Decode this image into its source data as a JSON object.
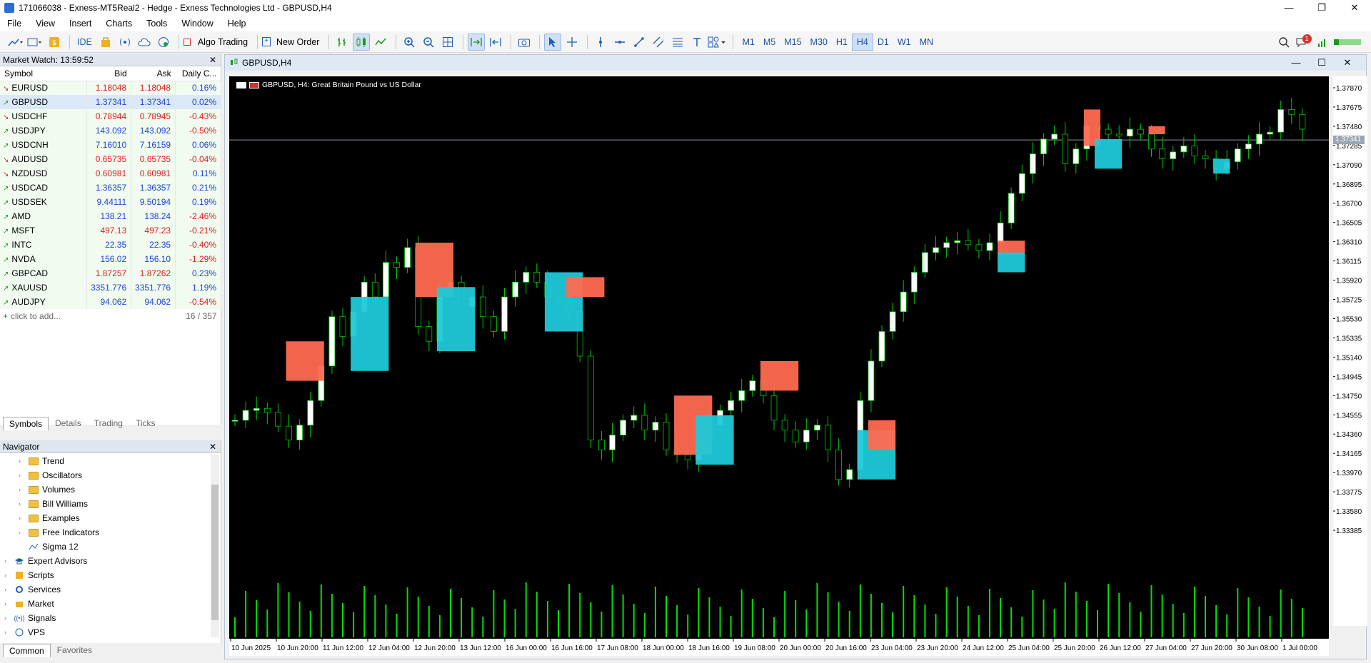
{
  "window": {
    "title": "171066038 - Exness-MT5Real2 - Hedge - Exness Technologies Ltd - GBPUSD,H4",
    "controls": [
      "—",
      "❐",
      "✕"
    ]
  },
  "menu": [
    "File",
    "View",
    "Insert",
    "Charts",
    "Tools",
    "Window",
    "Help"
  ],
  "toolbar": {
    "ide": "IDE",
    "algo_trading": "Algo Trading",
    "new_order": "New Order",
    "timeframes": [
      "M1",
      "M5",
      "M15",
      "M30",
      "H1",
      "H4",
      "D1",
      "W1",
      "MN"
    ],
    "active_timeframe": "H4",
    "notifications": "1"
  },
  "market_watch": {
    "title": "Market Watch: 13:59:52",
    "columns": [
      "Symbol",
      "Bid",
      "Ask",
      "Daily C..."
    ],
    "rows": [
      {
        "symbol": "EURUSD",
        "dir": "down",
        "bid": "1.18048",
        "ask": "1.18048",
        "change": "0.16%",
        "color": "red"
      },
      {
        "symbol": "GBPUSD",
        "dir": "up",
        "bid": "1.37341",
        "ask": "1.37341",
        "change": "0.02%",
        "color": "blue"
      },
      {
        "symbol": "USDCHF",
        "dir": "down",
        "bid": "0.78944",
        "ask": "0.78945",
        "change": "-0.43%",
        "color": "red"
      },
      {
        "symbol": "USDJPY",
        "dir": "up",
        "bid": "143.092",
        "ask": "143.092",
        "change": "-0.50%",
        "color": "blue"
      },
      {
        "symbol": "USDCNH",
        "dir": "up",
        "bid": "7.16010",
        "ask": "7.16159",
        "change": "0.06%",
        "color": "blue"
      },
      {
        "symbol": "AUDUSD",
        "dir": "down",
        "bid": "0.65735",
        "ask": "0.65735",
        "change": "-0.04%",
        "color": "red"
      },
      {
        "symbol": "NZDUSD",
        "dir": "down",
        "bid": "0.60981",
        "ask": "0.60981",
        "change": "0.11%",
        "color": "red"
      },
      {
        "symbol": "USDCAD",
        "dir": "up",
        "bid": "1.36357",
        "ask": "1.36357",
        "change": "0.21%",
        "color": "blue"
      },
      {
        "symbol": "USDSEK",
        "dir": "up",
        "bid": "9.44111",
        "ask": "9.50194",
        "change": "0.19%",
        "color": "blue"
      },
      {
        "symbol": "AMD",
        "dir": "up",
        "bid": "138.21",
        "ask": "138.24",
        "change": "-2.46%",
        "color": "blue"
      },
      {
        "symbol": "MSFT",
        "dir": "up",
        "bid": "497.13",
        "ask": "497.23",
        "change": "-0.21%",
        "color": "red"
      },
      {
        "symbol": "INTC",
        "dir": "up",
        "bid": "22.35",
        "ask": "22.35",
        "change": "-0.40%",
        "color": "blue"
      },
      {
        "symbol": "NVDA",
        "dir": "up",
        "bid": "156.02",
        "ask": "156.10",
        "change": "-1.29%",
        "color": "blue"
      },
      {
        "symbol": "GBPCAD",
        "dir": "up",
        "bid": "1.87257",
        "ask": "1.87262",
        "change": "0.23%",
        "color": "red"
      },
      {
        "symbol": "XAUUSD",
        "dir": "up",
        "bid": "3351.776",
        "ask": "3351.776",
        "change": "1.19%",
        "color": "blue"
      },
      {
        "symbol": "AUDJPY",
        "dir": "up",
        "bid": "94.062",
        "ask": "94.062",
        "change": "-0.54%",
        "color": "blue"
      }
    ],
    "add_label": "click to add...",
    "count": "16 / 357",
    "tabs": [
      "Symbols",
      "Details",
      "Trading",
      "Ticks"
    ]
  },
  "navigator": {
    "title": "Navigator",
    "items": [
      {
        "label": "Trend",
        "level": 2,
        "icon": "folder"
      },
      {
        "label": "Oscillators",
        "level": 2,
        "icon": "folder"
      },
      {
        "label": "Volumes",
        "level": 2,
        "icon": "folder"
      },
      {
        "label": "Bill Williams",
        "level": 2,
        "icon": "folder"
      },
      {
        "label": "Examples",
        "level": 2,
        "icon": "folder"
      },
      {
        "label": "Free Indicators",
        "level": 2,
        "icon": "folder"
      },
      {
        "label": "Sigma 12",
        "level": 2,
        "icon": "indicator"
      },
      {
        "label": "Expert Advisors",
        "level": 1,
        "icon": "hat"
      },
      {
        "label": "Scripts",
        "level": 1,
        "icon": "script"
      },
      {
        "label": "Services",
        "level": 1,
        "icon": "service"
      },
      {
        "label": "Market",
        "level": 1,
        "icon": "market"
      },
      {
        "label": "Signals",
        "level": 1,
        "icon": "signal"
      },
      {
        "label": "VPS",
        "level": 1,
        "icon": "vps"
      }
    ],
    "tabs": [
      "Common",
      "Favorites"
    ]
  },
  "chart": {
    "window_title": "GBPUSD,H4",
    "label": "GBPUSD, H4:  Great Britain Pound vs US Dollar",
    "current_price": "1.37341",
    "price_ticks": [
      "1.37870",
      "1.37675",
      "1.37480",
      "1.37285",
      "1.37090",
      "1.36895",
      "1.36700",
      "1.36505",
      "1.36310",
      "1.36115",
      "1.35920",
      "1.35725",
      "1.35530",
      "1.35335",
      "1.35140",
      "1.34945",
      "1.34750",
      "1.34555",
      "1.34360",
      "1.34165",
      "1.33970",
      "1.33775",
      "1.33580",
      "1.33385"
    ],
    "time_ticks": [
      "10 Jun 2025",
      "10 Jun 20:00",
      "11 Jun 12:00",
      "12 Jun 04:00",
      "12 Jun 20:00",
      "13 Jun 12:00",
      "16 Jun 00:00",
      "16 Jun 16:00",
      "17 Jun 08:00",
      "18 Jun 00:00",
      "18 Jun 16:00",
      "19 Jun 08:00",
      "20 Jun 00:00",
      "20 Jun 16:00",
      "23 Jun 04:00",
      "23 Jun 20:00",
      "24 Jun 12:00",
      "25 Jun 04:00",
      "25 Jun 20:00",
      "26 Jun 12:00",
      "27 Jun 04:00",
      "27 Jun 20:00",
      "30 Jun 08:00",
      "1 Jul 00:00"
    ],
    "colors": {
      "bg": "#000000",
      "bull_body": "#ffffff",
      "bear_body": "#000000",
      "wick": "#00c800",
      "supply_zone": "#ff6a50",
      "demand_zone": "#1fc8d8",
      "volume": "#00e000"
    }
  }
}
